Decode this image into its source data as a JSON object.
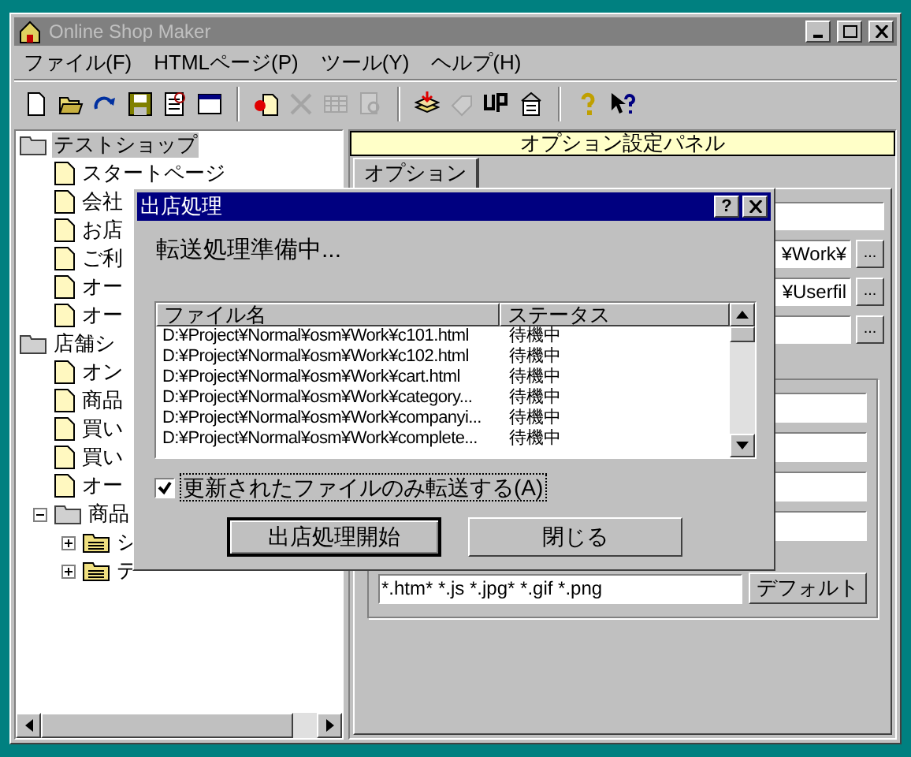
{
  "window": {
    "title": "Online Shop Maker"
  },
  "menu": [
    {
      "label": "ファイル(F)"
    },
    {
      "label": "HTMLページ(P)"
    },
    {
      "label": "ツール(Y)"
    },
    {
      "label": "ヘルプ(H)"
    }
  ],
  "toolbar": [
    {
      "kind": "new",
      "disabled": false
    },
    {
      "kind": "open",
      "disabled": false
    },
    {
      "kind": "redo",
      "disabled": false
    },
    {
      "kind": "save",
      "disabled": false
    },
    {
      "kind": "sheet",
      "disabled": false
    },
    {
      "kind": "window",
      "disabled": false
    },
    {
      "kind": "separator"
    },
    {
      "kind": "add",
      "disabled": false
    },
    {
      "kind": "delete",
      "disabled": true
    },
    {
      "kind": "table",
      "disabled": true
    },
    {
      "kind": "preview",
      "disabled": true
    },
    {
      "kind": "separator"
    },
    {
      "kind": "publish",
      "disabled": false
    },
    {
      "kind": "tag",
      "disabled": true
    },
    {
      "kind": "upload",
      "disabled": false
    },
    {
      "kind": "properties",
      "disabled": false
    },
    {
      "kind": "separator"
    },
    {
      "kind": "help",
      "disabled": false
    },
    {
      "kind": "context_help",
      "disabled": false
    }
  ],
  "tree": [
    {
      "label": "テストショップ",
      "kind": "folder",
      "selected": true,
      "children": [
        {
          "label": "スタートページ",
          "kind": "page",
          "selected": false
        },
        {
          "label": "会社",
          "kind": "page",
          "selected": false
        },
        {
          "label": "お店",
          "kind": "page",
          "selected": false
        },
        {
          "label": "ご利",
          "kind": "page",
          "selected": false
        },
        {
          "label": "オー",
          "kind": "page",
          "selected": false
        },
        {
          "label": "オー",
          "kind": "page",
          "selected": false
        }
      ]
    },
    {
      "label": "店舗シ",
      "kind": "folder",
      "selected": false,
      "children": [
        {
          "label": "オン",
          "kind": "page",
          "selected": false
        },
        {
          "label": "商品",
          "kind": "page",
          "selected": false
        },
        {
          "label": "買い",
          "kind": "page",
          "selected": false
        },
        {
          "label": "買い",
          "kind": "page",
          "selected": false
        },
        {
          "label": "オー",
          "kind": "page",
          "selected": false
        },
        {
          "label": "商品",
          "kind": "folder",
          "selected": false,
          "expanded": true,
          "children": [
            {
              "label": "シ",
              "kind": "category",
              "selected": false,
              "expanded": false
            },
            {
              "label": "テ",
              "kind": "category",
              "selected": false,
              "expanded": false
            }
          ]
        }
      ]
    }
  ],
  "panel": {
    "header": "オプション設定パネル",
    "tabs": [
      {
        "label": "オプション",
        "selected": true
      }
    ],
    "paths": [
      {
        "value": "¥Work¥",
        "button": "..."
      },
      {
        "value": "¥Userfil",
        "button": "..."
      },
      {
        "button": "..."
      }
    ],
    "pattern": {
      "value": "*.htm* *.js *.jpg* *.gif *.png",
      "button": "デフォルト"
    }
  },
  "dialog": {
    "title": "出店処理",
    "help": "?",
    "message": "転送処理準備中...",
    "columns": [
      "ファイル名",
      "ステータス"
    ],
    "rows": [
      {
        "file": "D:¥Project¥Normal¥osm¥Work¥c101.html",
        "status": "待機中"
      },
      {
        "file": "D:¥Project¥Normal¥osm¥Work¥c102.html",
        "status": "待機中"
      },
      {
        "file": "D:¥Project¥Normal¥osm¥Work¥cart.html",
        "status": "待機中"
      },
      {
        "file": "D:¥Project¥Normal¥osm¥Work¥category...",
        "status": "待機中"
      },
      {
        "file": "D:¥Project¥Normal¥osm¥Work¥companyi...",
        "status": "待機中"
      },
      {
        "file": "D:¥Project¥Normal¥osm¥Work¥complete...",
        "status": "待機中"
      }
    ],
    "checkbox": {
      "label": "更新されたファイルのみ転送する(A)",
      "checked": true
    },
    "buttons": [
      {
        "label": "出店処理開始",
        "default": true
      },
      {
        "label": "閉じる",
        "default": false
      }
    ]
  }
}
